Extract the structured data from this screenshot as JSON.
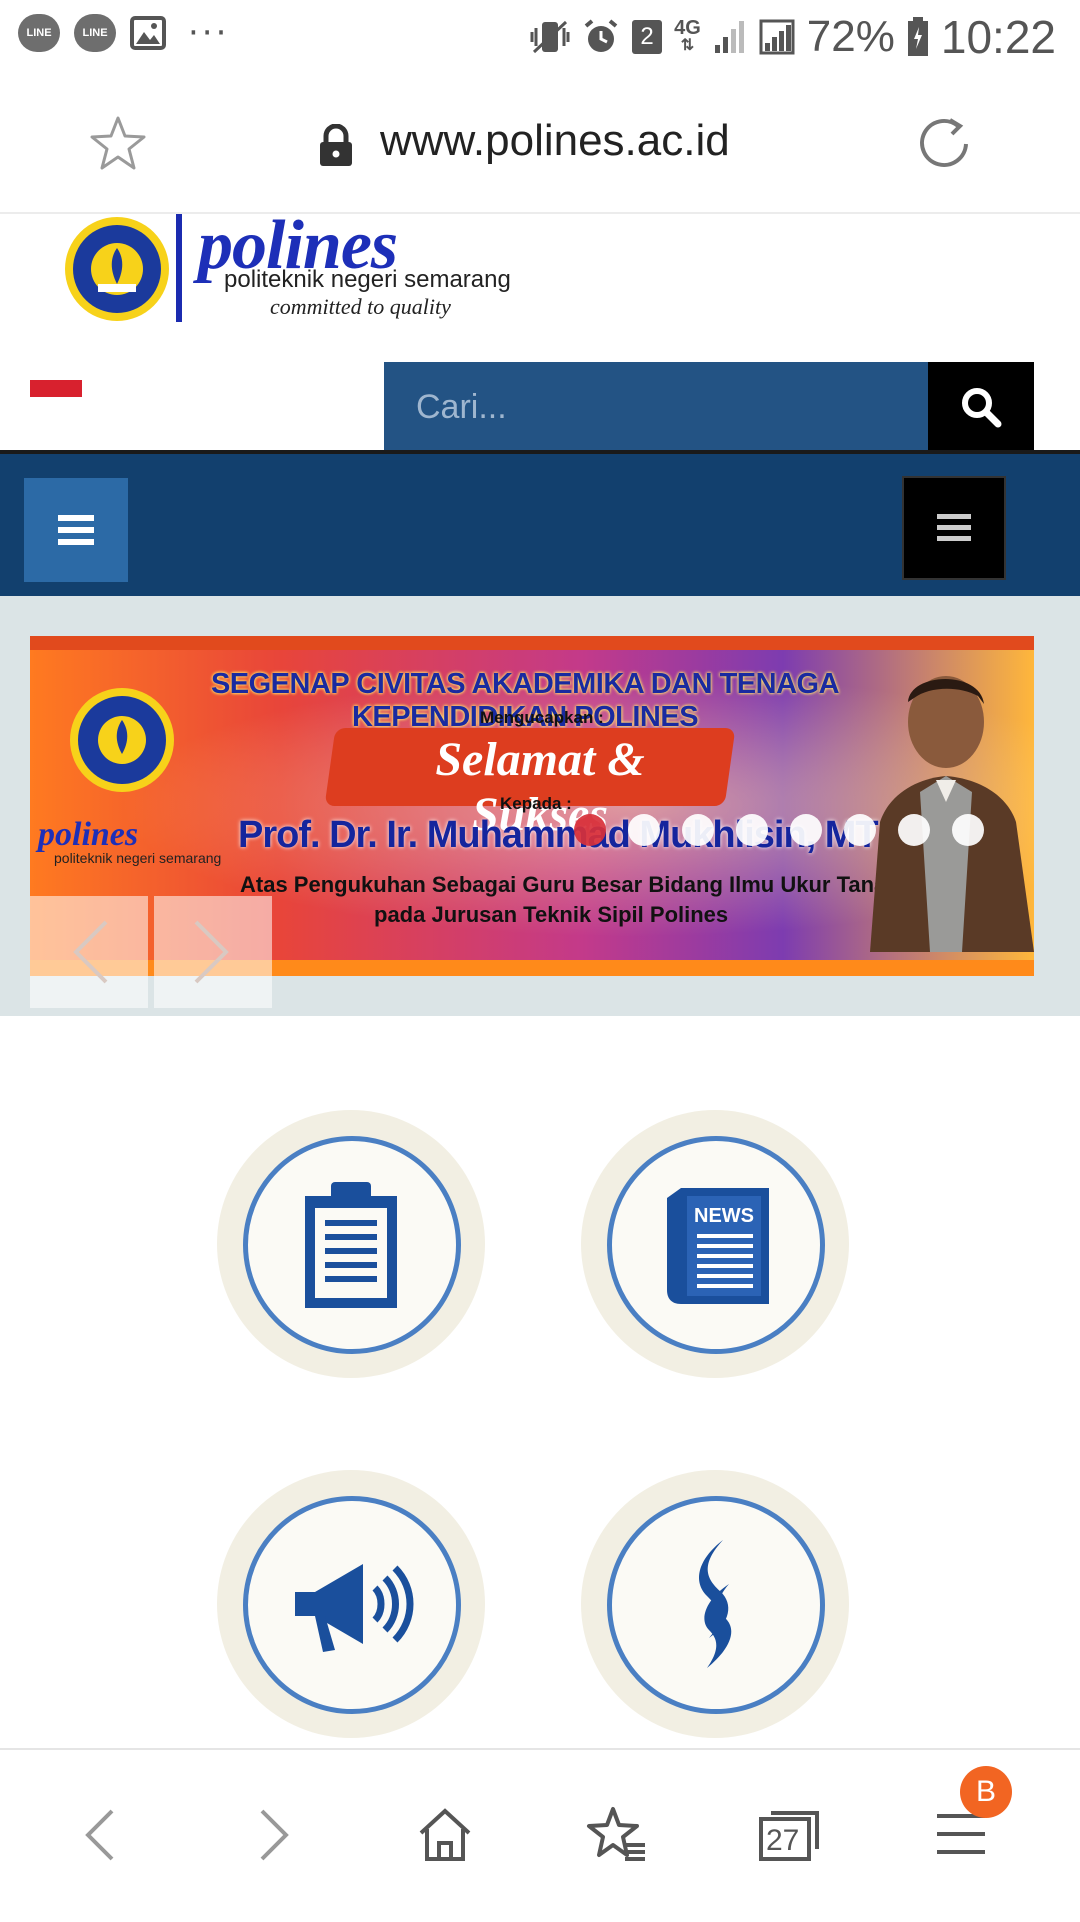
{
  "status_bar": {
    "left_icons": [
      "LINE",
      "LINE"
    ],
    "sim_number": "2",
    "network": "4G",
    "battery_percent": "72%",
    "time": "10:22"
  },
  "address_bar": {
    "url": "www.polines.ac.id"
  },
  "header": {
    "logo_word": "polines",
    "logo_subtitle": "politeknik negeri semarang",
    "logo_tagline": "committed to quality",
    "search_placeholder": "Cari..."
  },
  "banner": {
    "headline": "SEGENAP CIVITAS AKADEMIKA DAN TENAGA KEPENDIDIKAN POLINES",
    "small1": "Mengucapkan :",
    "script": "Selamat & Sukses",
    "small2": "Kepada :",
    "name": "Prof. Dr. Ir. Muhammad Mukhlisin, MT",
    "line1": "Atas Pengukuhan Sebagai Guru Besar Bidang Ilmu Ukur Tanah",
    "line2": "pada Jurusan Teknik Sipil Polines",
    "logo_word": "polines",
    "logo_subtitle": "politeknik negeri semarang",
    "slide_count": 8,
    "active_slide": 1
  },
  "quick_links": [
    "clipboard-icon",
    "news-icon",
    "megaphone-icon",
    "flame-icon"
  ],
  "bottom_bar": {
    "tabs_count": "27",
    "menu_badge": "B"
  }
}
